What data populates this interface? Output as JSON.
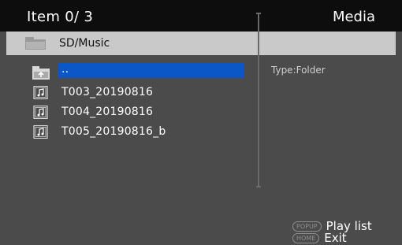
{
  "header": {
    "item_count": "Item 0/ 3",
    "title": "Media"
  },
  "path": {
    "text": "SD/Music",
    "icon": "folder-icon"
  },
  "list": {
    "items": [
      {
        "label": "..",
        "icon": "parent-folder-icon",
        "selected": true
      },
      {
        "label": "T003_20190816",
        "icon": "music-file-icon"
      },
      {
        "label": "T004_20190816",
        "icon": "music-file-icon"
      },
      {
        "label": "T005_20190816_b",
        "icon": "music-file-icon"
      }
    ]
  },
  "info": {
    "type": "Type:Folder"
  },
  "hints": [
    {
      "key": "POPUP",
      "action": "Play list"
    },
    {
      "key": "HOME",
      "action": "Exit"
    }
  ],
  "colors": {
    "background": "#4b4b4b",
    "header": "#0d0d0d",
    "pathbar": "#c9c9c9",
    "selection": "#0c57c8"
  }
}
